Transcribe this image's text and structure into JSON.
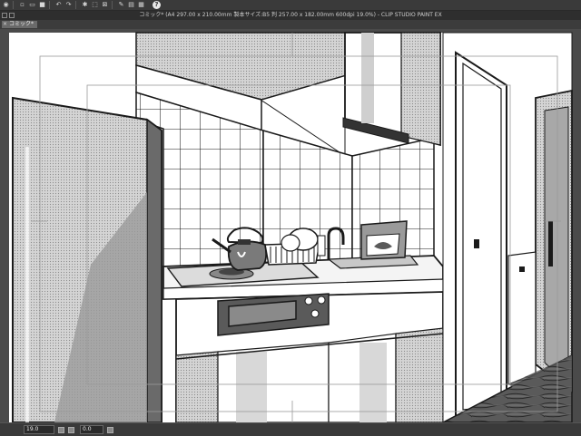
{
  "toolbar": {
    "icons": [
      "eye-icon",
      "new-file-icon",
      "open-icon",
      "save-icon",
      "undo-icon",
      "redo-icon",
      "transform-icon",
      "select-icon",
      "pen-icon",
      "help-icon"
    ],
    "help_glyph": "?"
  },
  "window": {
    "title": "コミック* (A4 297.00 x 210.00mm 製本サイズ:B5 判 257.00 x 182.00mm 600dpi 19.0%)  - CLIP STUDIO PAINT EX"
  },
  "tabs": [
    {
      "label": "コミック*",
      "close_glyph": "×"
    }
  ],
  "statusbar": {
    "zoom": "19.0",
    "rotation": "0.0"
  },
  "colors": {
    "ui_dark": "#3a3a3a",
    "canvas_bg": "#4a4a4a",
    "paper": "#ffffff",
    "line": "#1a1a1a",
    "tone_gray": "#b5b5b5",
    "tone_dark": "#7a7a7a"
  }
}
